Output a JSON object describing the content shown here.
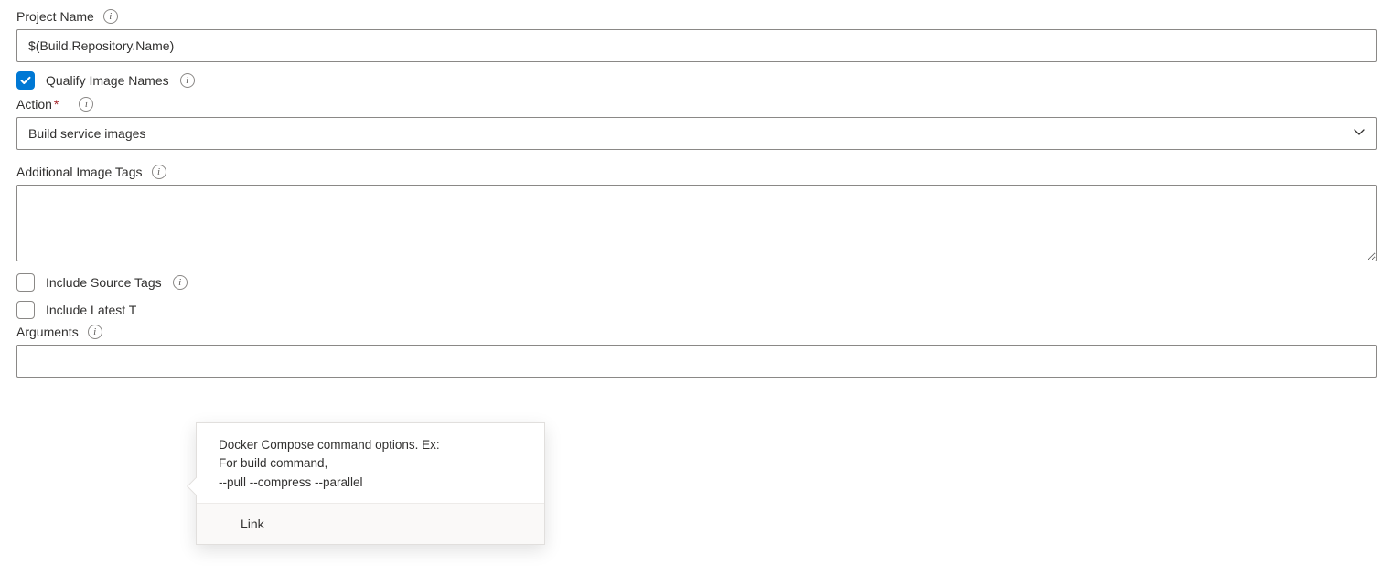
{
  "project_name": {
    "label": "Project Name",
    "value": "$(Build.Repository.Name)"
  },
  "qualify_image_names": {
    "label": "Qualify Image Names",
    "checked": true
  },
  "action": {
    "label": "Action",
    "required_mark": "*",
    "value": "Build service images"
  },
  "additional_image_tags": {
    "label": "Additional Image Tags",
    "value": ""
  },
  "include_source_tags": {
    "label": "Include Source Tags",
    "checked": false
  },
  "include_latest_tag": {
    "label": "Include Latest T",
    "checked": false
  },
  "arguments": {
    "label": "Arguments",
    "value": ""
  },
  "tooltip": {
    "line1": "Docker Compose command options. Ex:",
    "line2": "For build command,",
    "line3": "--pull --compress --parallel",
    "link_label": "Link"
  }
}
